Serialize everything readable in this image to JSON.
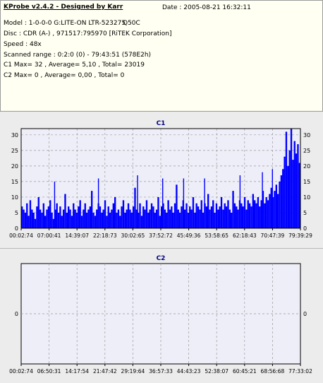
{
  "header": {
    "app_title": "KProbe v2.4.2 - Designed by Karr",
    "date": "Date : 2005-08-21 16:32:11"
  },
  "info_lines": {
    "model": "Model : 1-0-0-0 G:LITE-ON LTR-523275",
    "firmware": "Q50C",
    "disc": "Disc : CDR (A-) , 971517:795970 [RiTEK Corporation]",
    "speed": "Speed : 48x",
    "scanned": "Scanned range : 0:2:0 (0) - 79:43:51 (578E2h)",
    "c1_summary": "C1 Max= 32 , Average= 5,10 , Total= 23019",
    "c2_summary": "C2 Max= 0 , Average= 0,00 , Total= 0"
  },
  "colors": {
    "plot_bg": "#eeeef8",
    "bar": "#0000ff",
    "grid": "#9a9a9a",
    "title": "#000080",
    "info_bg": "#fffff2"
  },
  "chart_data": [
    {
      "type": "bar",
      "title": "C1",
      "ylim": [
        0,
        32
      ],
      "yticks": [
        "0",
        "5",
        "10",
        "15",
        "20",
        "25",
        "30"
      ],
      "xticks": [
        "00:02:74",
        "07:00:41",
        "14:39:07",
        "22:18:73",
        "30:02:65",
        "37:52:72",
        "45:49:36",
        "53:58:65",
        "62:18:43",
        "70:47:39",
        "79:39:29"
      ],
      "grid": true,
      "values": [
        7,
        6,
        5,
        8,
        4,
        9,
        6,
        5,
        3,
        7,
        10,
        6,
        5,
        8,
        4,
        6,
        7,
        9,
        5,
        3,
        6,
        8,
        5,
        7,
        4,
        6,
        11,
        5,
        7,
        6,
        4,
        8,
        6,
        5,
        7,
        9,
        4,
        6,
        8,
        5,
        6,
        7,
        12,
        5,
        4,
        6,
        8,
        7,
        5,
        6,
        9,
        4,
        7,
        5,
        6,
        8,
        10,
        5,
        6,
        4,
        7,
        9,
        5,
        6,
        8,
        6,
        5,
        7,
        13,
        6,
        5,
        8,
        4,
        7,
        6,
        9,
        5,
        6,
        8,
        7,
        5,
        6,
        10,
        4,
        7,
        8,
        6,
        5,
        9,
        6,
        7,
        5,
        8,
        14,
        6,
        5,
        7,
        9,
        6,
        8,
        5,
        7,
        6,
        10,
        5,
        8,
        7,
        6,
        9,
        5,
        8,
        7,
        11,
        6,
        7,
        9,
        5,
        8,
        6,
        7,
        10,
        6,
        8,
        7,
        9,
        6,
        5,
        12,
        8,
        7,
        6,
        9,
        8,
        7,
        10,
        6,
        9,
        8,
        7,
        11,
        9,
        8,
        10,
        7,
        9,
        12,
        8,
        10,
        9,
        11,
        13,
        10,
        12,
        14,
        11,
        15,
        17,
        19,
        23,
        31,
        20,
        25,
        32,
        22,
        28,
        24,
        27,
        21
      ],
      "peaks": [
        {
          "pos": 0.118,
          "value": 15
        },
        {
          "pos": 0.275,
          "value": 16
        },
        {
          "pos": 0.415,
          "value": 17
        },
        {
          "pos": 0.505,
          "value": 16
        },
        {
          "pos": 0.58,
          "value": 16
        },
        {
          "pos": 0.655,
          "value": 16
        },
        {
          "pos": 0.782,
          "value": 17
        },
        {
          "pos": 0.862,
          "value": 18
        },
        {
          "pos": 0.898,
          "value": 19
        }
      ]
    },
    {
      "type": "bar",
      "title": "C2",
      "ylim": [
        -1,
        1
      ],
      "yticks": [
        "0"
      ],
      "xticks": [
        "00:02:74",
        "06:50:31",
        "14:17:54",
        "21:47:42",
        "29:19:64",
        "36:57:33",
        "44:43:23",
        "52:38:07",
        "60:45:21",
        "68:56:68",
        "77:33:02"
      ],
      "grid": true,
      "values": [
        0
      ]
    }
  ]
}
